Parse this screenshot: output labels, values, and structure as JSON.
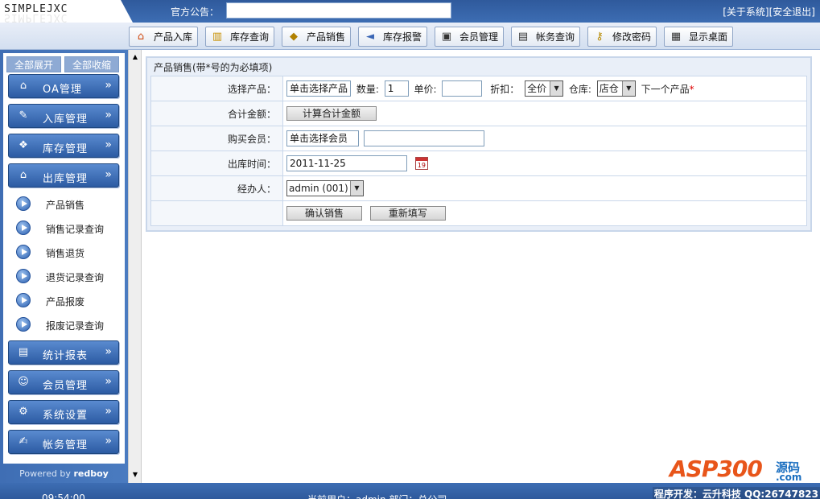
{
  "header": {
    "logo": "SIMPLEJXC",
    "notice_label": "官方公告：",
    "notice_value": "",
    "about_link": "[关于系统]",
    "logout_link": "[安全退出]"
  },
  "toolbar": {
    "buttons": [
      {
        "label": "产品入库",
        "icon": "home-arrow-icon"
      },
      {
        "label": "库存查询",
        "icon": "book-icon"
      },
      {
        "label": "产品销售",
        "icon": "tag-icon"
      },
      {
        "label": "库存报警",
        "icon": "speaker-icon"
      },
      {
        "label": "会员管理",
        "icon": "member-card-icon"
      },
      {
        "label": "帐务查询",
        "icon": "document-icon"
      },
      {
        "label": "修改密码",
        "icon": "key-icon"
      },
      {
        "label": "显示桌面",
        "icon": "desktop-icon"
      }
    ]
  },
  "sidebar": {
    "expand_all": "全部展开",
    "collapse_all": "全部收缩",
    "menus": [
      {
        "label": "OA管理",
        "icon": "home-icon"
      },
      {
        "label": "入库管理",
        "icon": "inbound-icon"
      },
      {
        "label": "库存管理",
        "icon": "inventory-icon"
      },
      {
        "label": "出库管理",
        "icon": "outbound-icon"
      },
      {
        "label": "统计报表",
        "icon": "report-icon"
      },
      {
        "label": "会员管理",
        "icon": "member-icon"
      },
      {
        "label": "系统设置",
        "icon": "settings-icon"
      },
      {
        "label": "帐务管理",
        "icon": "account-icon"
      }
    ],
    "submenu": [
      "产品销售",
      "销售记录查询",
      "销售退货",
      "退货记录查询",
      "产品报废",
      "报废记录查询"
    ],
    "powered_prefix": "Powered by ",
    "powered_name": "redboy"
  },
  "panel": {
    "title": "产品销售(带*号的为必填项)",
    "rows": {
      "product_label": "选择产品：",
      "product_button": "单击选择产品",
      "qty_label": "数量:",
      "qty_value": "1",
      "price_label": "单价:",
      "price_value": "",
      "discount_label": "折扣：",
      "discount_value": "全价",
      "warehouse_label": "仓库:",
      "warehouse_value": "店仓",
      "next_product": "下一个产品",
      "required_mark": "*",
      "total_label": "合计金额：",
      "calc_button": "计算合计金额",
      "member_label": "购买会员：",
      "member_button": "单击选择会员",
      "member_value": "",
      "date_label": "出库时间：",
      "date_value": "2011-11-25",
      "calendar_day": "19",
      "operator_label": "经办人：",
      "operator_value": "admin (001)",
      "confirm_button": "确认销售",
      "reset_button": "重新填写"
    }
  },
  "footer": {
    "time": "09:54:00",
    "user": "当前用户：admin   部门：总公司",
    "developer": "程序开发：云升科技 QQ:26747823"
  },
  "watermark": {
    "brand": "ASP300",
    "side": "源码",
    "domain": ".com"
  }
}
